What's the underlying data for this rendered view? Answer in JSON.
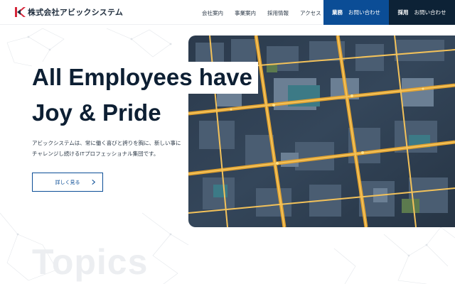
{
  "header": {
    "logo_text": "株式会社アビックシステム",
    "nav": [
      "会社案内",
      "事業案内",
      "採用情報",
      "アクセス"
    ],
    "cta_business": {
      "strong": "業務",
      "label": "お問い合わせ"
    },
    "cta_recruit": {
      "strong": "採用",
      "label": "お問い合わせ"
    }
  },
  "hero": {
    "headline_line1": "All Employees have",
    "headline_line2": "Joy & Pride",
    "description": "アビックシステムは、常に働く喜びと誇りを胸に、新しい事にチャレンジし続けるITプロフェッショナル集団です。",
    "more_button": "詳しく見る"
  },
  "section": {
    "topics_title": "Topics"
  },
  "colors": {
    "brand_blue": "#0b4d96",
    "dark_navy": "#0d2236",
    "headline": "#0d1f33",
    "logo_red": "#d6263a"
  }
}
